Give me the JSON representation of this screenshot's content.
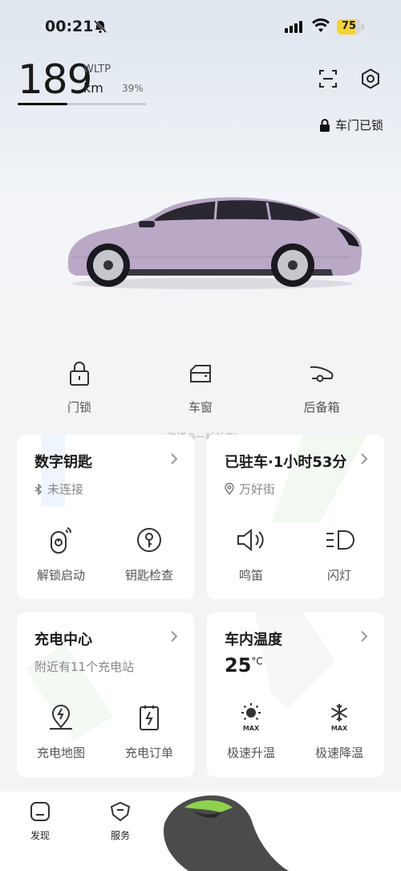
{
  "status_bar": {
    "time": "00:21",
    "battery": "75",
    "battery_level": 0.75
  },
  "range": {
    "value": "189",
    "unit": "km",
    "standard": "WLTP",
    "percent": "39%",
    "bar_level": 0.39
  },
  "lock_status": "车门已锁",
  "quick_controls": [
    {
      "label": "门锁",
      "icon": "lock-icon"
    },
    {
      "label": "车窗",
      "icon": "window-icon"
    },
    {
      "label": "后备箱",
      "icon": "trunk-icon"
    }
  ],
  "watermark": "微博@一杉杉辛L",
  "cards": {
    "digital_key": {
      "title": "数字钥匙",
      "status": "未连接",
      "actions": [
        {
          "label": "解锁启动",
          "icon": "unlock-start-icon"
        },
        {
          "label": "钥匙检查",
          "icon": "key-check-icon"
        }
      ]
    },
    "parking": {
      "title": "已驻车·1小时53分",
      "location": "万好街",
      "actions": [
        {
          "label": "鸣笛",
          "icon": "horn-icon"
        },
        {
          "label": "闪灯",
          "icon": "flash-lights-icon"
        }
      ]
    },
    "charging": {
      "title": "充电中心",
      "subtitle": "附近有11个充电站",
      "actions": [
        {
          "label": "充电地图",
          "icon": "charge-map-icon"
        },
        {
          "label": "充电订单",
          "icon": "charge-order-icon"
        }
      ]
    },
    "climate": {
      "title": "车内温度",
      "temperature": "25",
      "temp_unit": "°C",
      "actions": [
        {
          "label": "极速升温",
          "icon": "max-heat-icon",
          "badge": "MAX"
        },
        {
          "label": "极速降温",
          "icon": "max-cool-icon",
          "badge": "MAX"
        }
      ]
    }
  },
  "bottom_nav": [
    {
      "label": "发现",
      "icon": "discover-icon"
    },
    {
      "label": "服务",
      "icon": "service-icon"
    }
  ],
  "colors": {
    "car_body": "#b9a9c6",
    "accent_green": "#8fd14f",
    "battery_fill": "#f6d233"
  }
}
